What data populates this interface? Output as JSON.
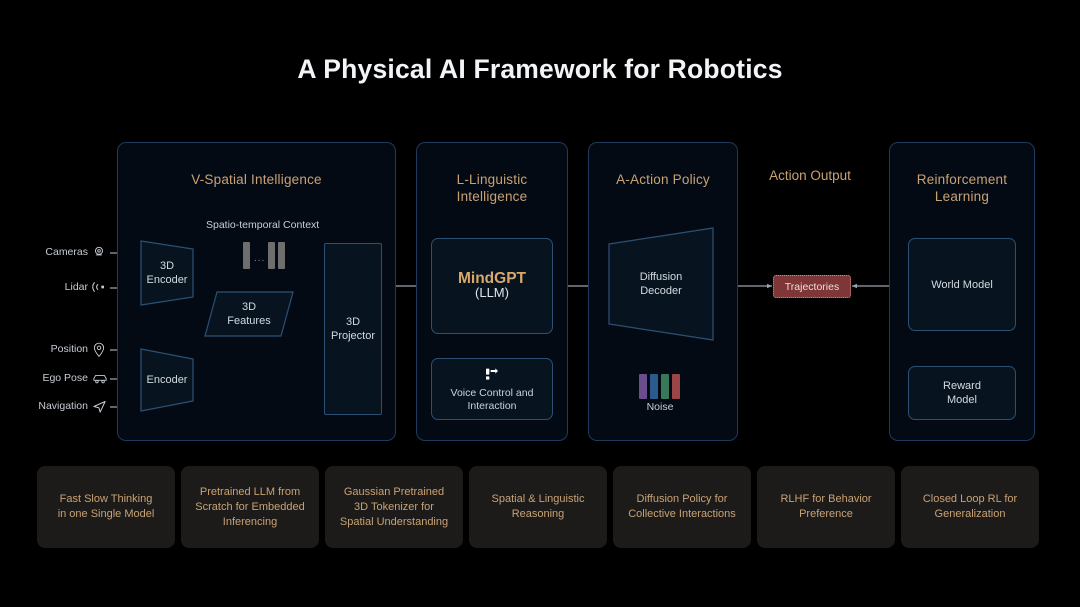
{
  "title": "A Physical AI Framework for Robotics",
  "colors": {
    "background": "#000000",
    "panel_border": "#1f3a5c",
    "panel_fill": "#040a14",
    "accent_tan": "#c9a274",
    "box_border": "#2c5074",
    "box_fill": "#07141f",
    "arrow": "#9aa3ac",
    "trajectory_fill": "#7e3637",
    "trajectory_border": "#d08a8a",
    "card_fill": "#1c1b19",
    "mindgpt_text": "#d9a86a"
  },
  "inputs": [
    {
      "label": "Cameras",
      "icon": "camera-icon"
    },
    {
      "label": "Lidar",
      "icon": "lidar-signal-icon"
    },
    {
      "label": "Position",
      "icon": "map-pin-icon"
    },
    {
      "label": "Ego Pose",
      "icon": "car-icon"
    },
    {
      "label": "Navigation",
      "icon": "navigation-arrow-icon"
    }
  ],
  "panels": [
    {
      "id": "spatial",
      "title": "V-Spatial Intelligence"
    },
    {
      "id": "linguistic",
      "title": "L-Linguistic\nIntelligence",
      "line1": "L-Linguistic",
      "line2": "Intelligence"
    },
    {
      "id": "action",
      "title": "A-Action Policy"
    },
    {
      "id": "output",
      "title": "Action Output"
    },
    {
      "id": "rl",
      "title": "Reinforcement\nLearning",
      "line1": "Reinforcement",
      "line2": "Learning"
    }
  ],
  "spatial": {
    "encoder_3d": {
      "line1": "3D",
      "line2": "Encoder"
    },
    "encoder": {
      "label": "Encoder"
    },
    "context_label": "Spatio-temporal Context",
    "context_dots": "...",
    "features_3d": {
      "line1": "3D",
      "line2": "Features"
    },
    "projector_3d": {
      "line1": "3D",
      "line2": "Projector"
    }
  },
  "linguistic": {
    "mindgpt_name": "MindGPT",
    "mindgpt_sub": "(LLM)",
    "voice": {
      "icon": "voice-control-icon",
      "line1": "Voice Control and",
      "line2": "Interaction"
    }
  },
  "action": {
    "decoder": {
      "line1": "Diffusion",
      "line2": "Decoder"
    },
    "noise_label": "Noise",
    "noise_colors": [
      "#6a4d8c",
      "#2b5a8d",
      "#37775a",
      "#9a4646"
    ]
  },
  "output": {
    "trajectories": "Trajectories"
  },
  "rl": {
    "world_model": "World Model",
    "reward_model": {
      "line1": "Reward",
      "line2": "Model"
    }
  },
  "cards": [
    {
      "line1": "Fast Slow Thinking",
      "line2": "in one Single Model",
      "line3": ""
    },
    {
      "line1": "Pretrained LLM from",
      "line2": "Scratch for Embedded",
      "line3": "Inferencing"
    },
    {
      "line1": "Gaussian Pretrained",
      "line2": "3D Tokenizer for",
      "line3": "Spatial Understanding"
    },
    {
      "line1": "Spatial & Linguistic",
      "line2": "Reasoning",
      "line3": ""
    },
    {
      "line1": "Diffusion Policy for",
      "line2": "Collective Interactions",
      "line3": ""
    },
    {
      "line1": "RLHF for Behavior",
      "line2": "Preference",
      "line3": ""
    },
    {
      "line1": "Closed Loop RL for",
      "line2": "Generalization",
      "line3": ""
    }
  ]
}
